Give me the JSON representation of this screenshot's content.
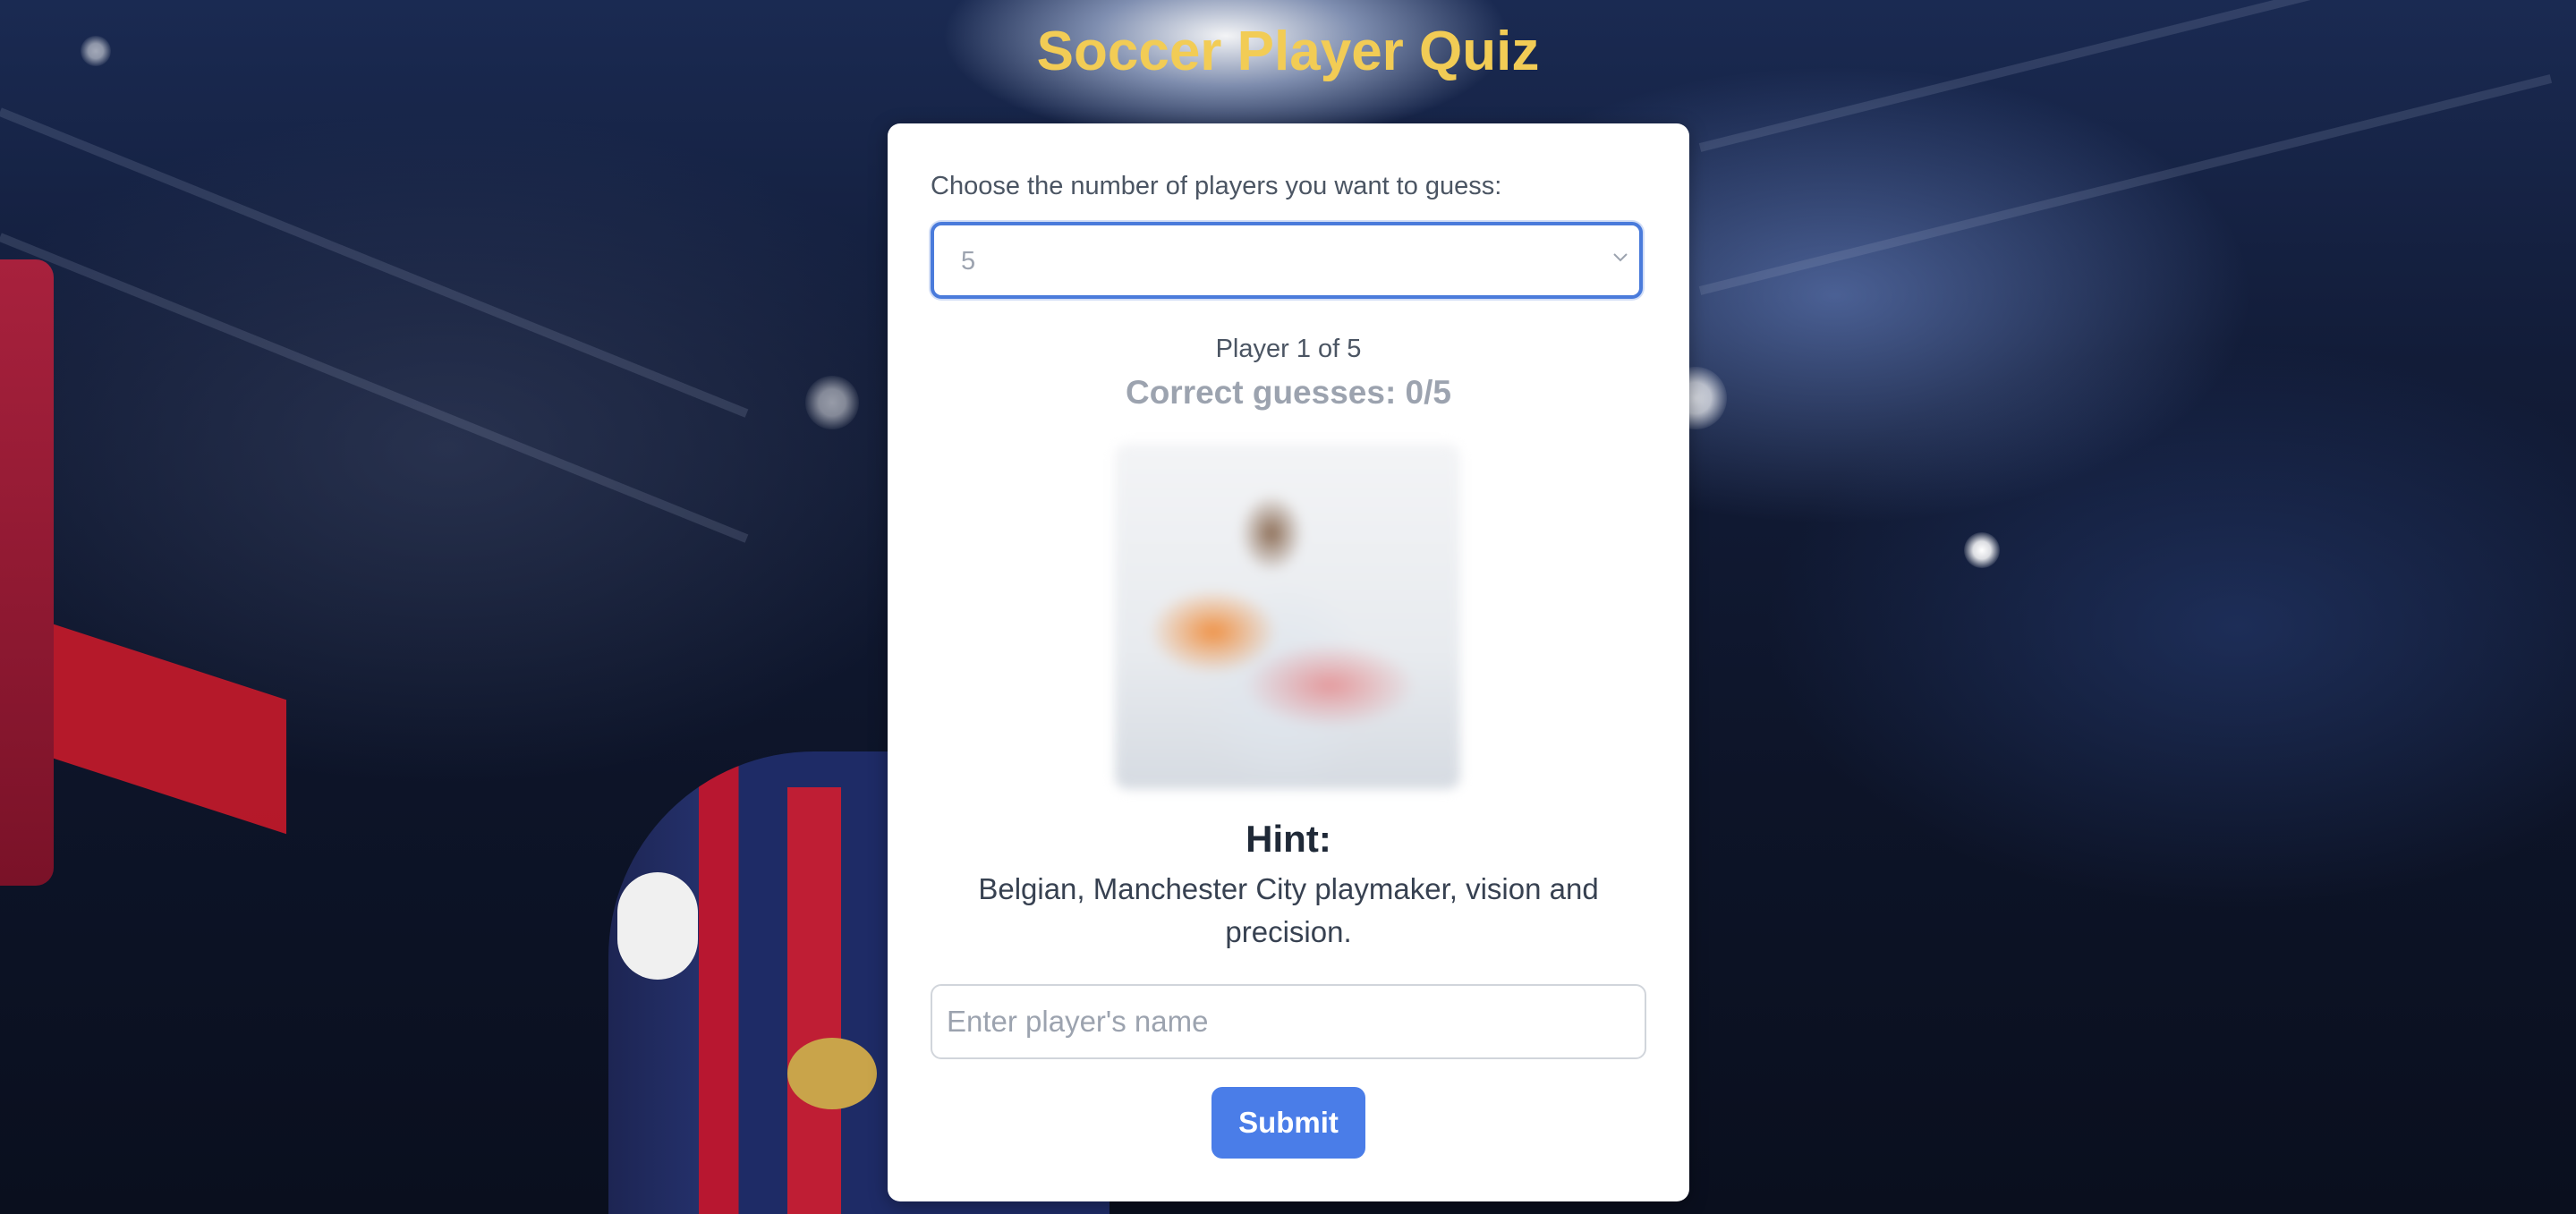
{
  "header": {
    "title": "Soccer Player Quiz"
  },
  "quiz": {
    "choose_label": "Choose the number of players you want to guess:",
    "player_count_select": {
      "selected_value": "5"
    },
    "progress_text": "Player 1 of 5",
    "score_text": "Correct guesses: 0/5",
    "hint_heading": "Hint:",
    "hint_text": "Belgian, Manchester City playmaker, vision and precision.",
    "name_input": {
      "value": "",
      "placeholder": "Enter player's name"
    },
    "submit_label": "Submit"
  },
  "colors": {
    "title": "#f2cc55",
    "accent": "#4a7de8",
    "select_focus_border": "#4a7bdb",
    "score_text": "#9ca3af"
  },
  "icons": {
    "select_chevron": "chevron-down-icon"
  }
}
